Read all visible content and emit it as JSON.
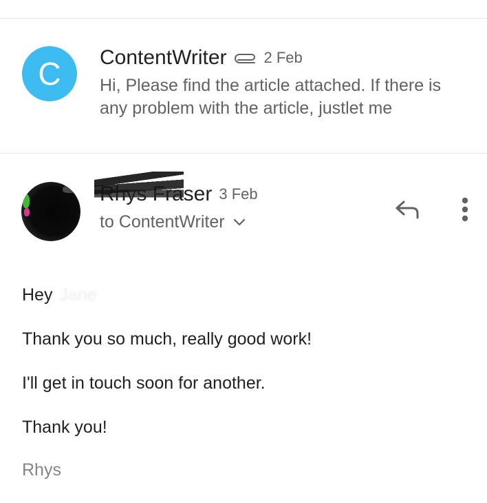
{
  "thread": {
    "message1": {
      "avatar_letter": "C",
      "avatar_color": "#3cbcf1",
      "sender": "ContentWriter",
      "attachment_icon": "paperclip-icon",
      "date": "2 Feb",
      "snippet": "Hi, Please find the article attached. If there is any problem with the article, justlet me"
    },
    "message2": {
      "sender": "Rhys Fraser",
      "date": "3 Feb",
      "recipient_line": "to ContentWriter",
      "reply_icon": "reply-icon",
      "more_icon": "more-vert-icon",
      "body": {
        "greeting": "Hey",
        "greeting_name": "Jane",
        "line1": "Thank you so much, really good work!",
        "line2": "I'll get in touch soon for another.",
        "line3": "Thank you!",
        "signature": "Rhys"
      }
    }
  }
}
